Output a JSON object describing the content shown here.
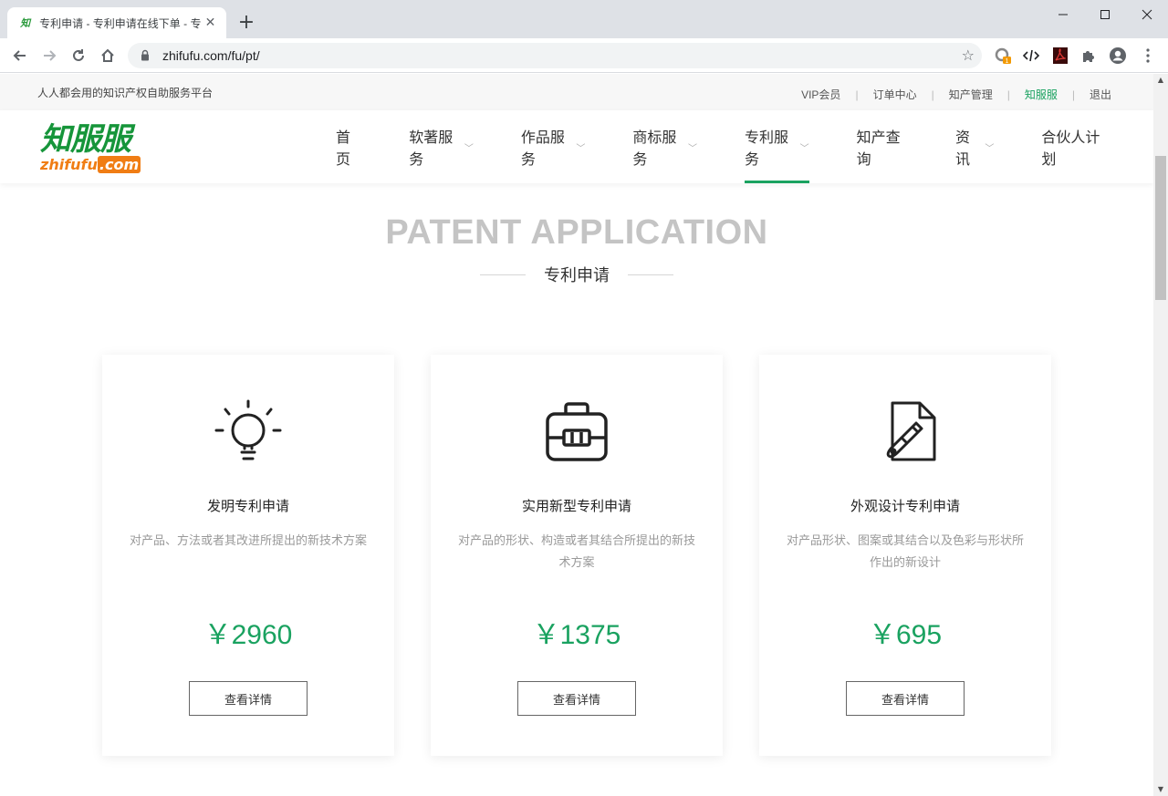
{
  "browser": {
    "tab_title": "专利申请 - 专利申请在线下单 - 专",
    "favicon_text": "知",
    "url": "zhifufu.com/fu/pt/",
    "extension_badge": "1"
  },
  "topbar": {
    "slogan": "人人都会用的知识产权自助服务平台",
    "links": [
      {
        "label": "VIP会员"
      },
      {
        "label": "订单中心"
      },
      {
        "label": "知产管理"
      },
      {
        "label": "知服服"
      },
      {
        "label": "退出"
      }
    ]
  },
  "header": {
    "logo_cn": "知服服",
    "logo_en_a": "zhifufu",
    "logo_en_b": ".com",
    "nav": [
      {
        "label": "首页",
        "has_caret": false
      },
      {
        "label": "软著服务",
        "has_caret": true
      },
      {
        "label": "作品服务",
        "has_caret": true
      },
      {
        "label": "商标服务",
        "has_caret": true
      },
      {
        "label": "专利服务",
        "has_caret": true,
        "active": true
      },
      {
        "label": "知产查询",
        "has_caret": false
      },
      {
        "label": "资讯",
        "has_caret": true
      },
      {
        "label": "合伙人计划",
        "has_caret": false
      }
    ]
  },
  "section": {
    "heading_en": "PATENT APPLICATION",
    "heading_cn": "专利申请"
  },
  "cards": [
    {
      "icon": "lightbulb-icon",
      "title": "发明专利申请",
      "desc": "对产品、方法或者其改进所提出的新技术方案",
      "price": "￥2960",
      "button": "查看详情"
    },
    {
      "icon": "toolbox-icon",
      "title": "实用新型专利申请",
      "desc": "对产品的形状、构造或者其结合所提出的新技术方案",
      "price": "￥1375",
      "button": "查看详情"
    },
    {
      "icon": "design-brush-icon",
      "title": "外观设计专利申请",
      "desc": "对产品形状、图案或其结合以及色彩与形状所作出的新设计",
      "price": "￥695",
      "button": "查看详情"
    }
  ],
  "colors": {
    "accent": "#1aa260",
    "logo_green": "#16953a",
    "logo_orange": "#f07d14",
    "heading_grey": "#c4c4c4"
  }
}
